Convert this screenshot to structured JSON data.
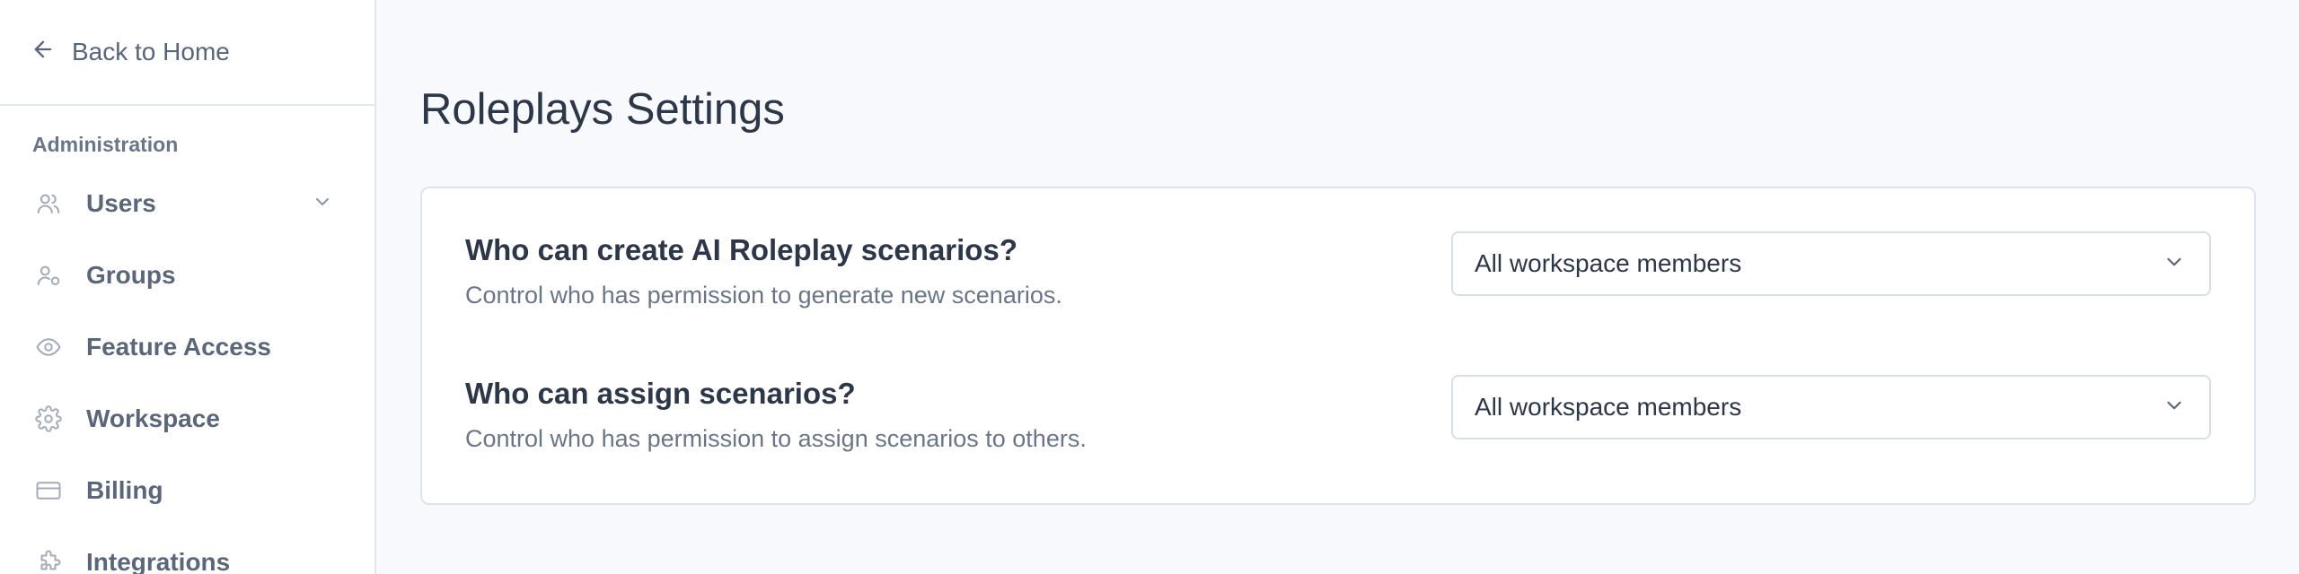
{
  "sidebar": {
    "back_label": "Back to Home",
    "section_label": "Administration",
    "items": [
      {
        "label": "Users",
        "icon": "users-icon",
        "has_chevron": true
      },
      {
        "label": "Groups",
        "icon": "user-group-icon"
      },
      {
        "label": "Feature Access",
        "icon": "eye-icon"
      },
      {
        "label": "Workspace",
        "icon": "gear-icon"
      },
      {
        "label": "Billing",
        "icon": "credit-card-icon"
      },
      {
        "label": "Integrations",
        "icon": "puzzle-icon"
      }
    ]
  },
  "main": {
    "title": "Roleplays Settings",
    "settings": [
      {
        "title": "Who can create AI Roleplay scenarios?",
        "description": "Control who has permission to generate new scenarios.",
        "selected": "All workspace members"
      },
      {
        "title": "Who can assign scenarios?",
        "description": "Control who has permission to assign scenarios to others.",
        "selected": "All workspace members"
      }
    ]
  },
  "colors": {
    "background": "#f8f9fc",
    "sidebar": "#ffffff",
    "text_primary": "#2d3748",
    "text_secondary": "#6b7588",
    "border": "#e2e6ee"
  }
}
